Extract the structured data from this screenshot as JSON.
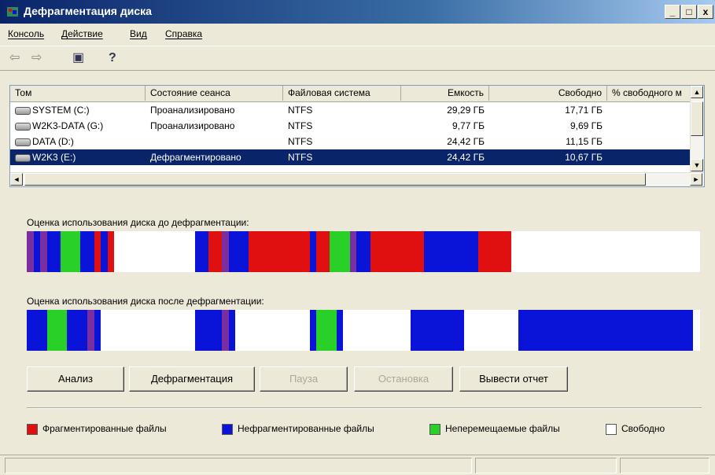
{
  "window": {
    "title": "Дефрагментация диска"
  },
  "titlebar_buttons": {
    "minimize": "_",
    "maximize": "□",
    "close": "x"
  },
  "menu": [
    {
      "label": "Консоль"
    },
    {
      "label": "Действие"
    },
    {
      "label": "Вид"
    },
    {
      "label": "Справка"
    }
  ],
  "toolbar": {
    "back": "⇦",
    "forward": "⇨",
    "view": "▣",
    "help": "?"
  },
  "table": {
    "headers": [
      "Том",
      "Состояние сеанса",
      "Файловая система",
      "Емкость",
      "Свободно",
      "% свободного м"
    ],
    "rows": [
      {
        "volume": "SYSTEM (C:)",
        "state": "Проанализировано",
        "fs": "NTFS",
        "capacity": "29,29 ГБ",
        "free": "17,71 ГБ"
      },
      {
        "volume": "W2K3-DATA (G:)",
        "state": "Проанализировано",
        "fs": "NTFS",
        "capacity": "9,77 ГБ",
        "free": "9,69 ГБ"
      },
      {
        "volume": "DATA (D:)",
        "state": "",
        "fs": "NTFS",
        "capacity": "24,42 ГБ",
        "free": "11,15 ГБ"
      },
      {
        "volume": "W2K3 (E:)",
        "state": "Дефрагментировано",
        "fs": "NTFS",
        "capacity": "24,42 ГБ",
        "free": "10,67 ГБ",
        "selected": true
      }
    ]
  },
  "before": {
    "label": "Оценка использования диска до дефрагментации:"
  },
  "after": {
    "label": "Оценка использования диска после дефрагментации:"
  },
  "buttons": {
    "analyze": "Анализ",
    "defrag": "Дефрагментация",
    "pause": "Пауза",
    "stop": "Остановка",
    "report": "Вывести отчет"
  },
  "legend": {
    "fragmented": "Фрагментированные файлы",
    "contiguous": "Нефрагментированные файлы",
    "unmovable": "Неперемещаемые файлы",
    "free": "Свободно"
  },
  "colors": {
    "fragmented": "#e01010",
    "contiguous": "#0a14d8",
    "unmovable": "#28d028",
    "free": "#ffffff",
    "system": "#7a2ea0"
  }
}
